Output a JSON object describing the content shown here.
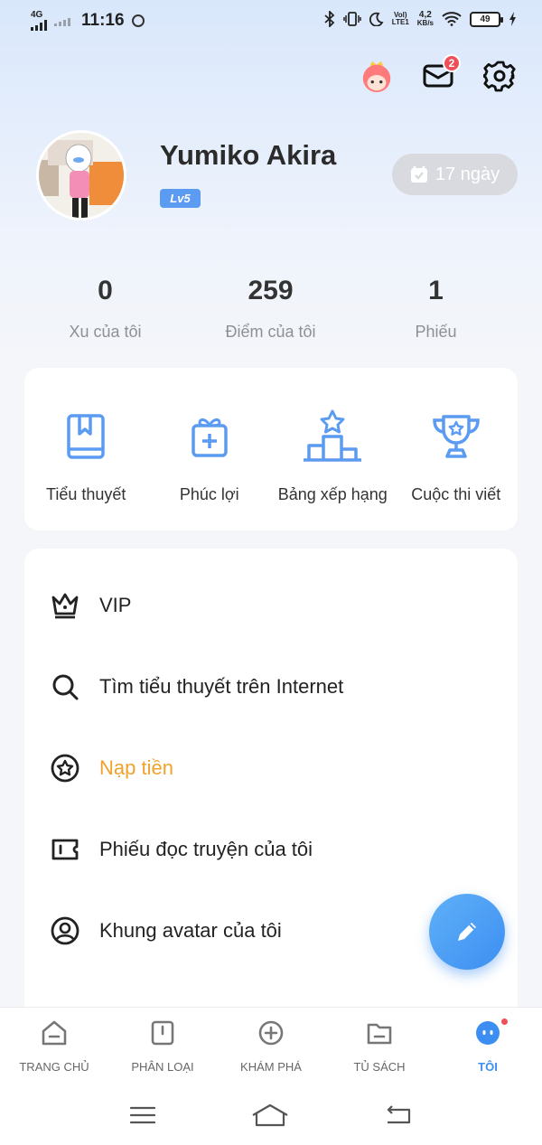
{
  "status_bar": {
    "network": "4G",
    "time": "11:16",
    "volte_top": "Vol)",
    "volte_bottom": "LTE1",
    "speed_top": "4,2",
    "speed_bottom": "KB/s",
    "battery": "49"
  },
  "header": {
    "mail_badge": "2"
  },
  "profile": {
    "name": "Yumiko Akira",
    "level": "Lv5",
    "checkin_label": "17 ngày"
  },
  "stats": [
    {
      "value": "0",
      "label": "Xu của tôi"
    },
    {
      "value": "259",
      "label": "Điểm của tôi"
    },
    {
      "value": "1",
      "label": "Phiếu"
    }
  ],
  "features": [
    {
      "label": "Tiểu thuyết",
      "icon": "book-icon"
    },
    {
      "label": "Phúc lợi",
      "icon": "gift-icon"
    },
    {
      "label": "Bảng xếp hạng",
      "icon": "podium-icon"
    },
    {
      "label": "Cuộc thi viết",
      "icon": "trophy-icon"
    }
  ],
  "menu": [
    {
      "label": "VIP",
      "icon": "crown-icon"
    },
    {
      "label": "Tìm tiểu thuyết trên Internet",
      "icon": "search-icon"
    },
    {
      "label": "Nạp tiền",
      "icon": "star-circle-icon"
    },
    {
      "label": "Phiếu đọc truyện của tôi",
      "icon": "ticket-icon"
    },
    {
      "label": "Khung avatar của tôi",
      "icon": "avatar-frame-icon"
    }
  ],
  "bottom_nav": [
    {
      "label": "TRANG CHỦ",
      "icon": "home-icon"
    },
    {
      "label": "PHÂN LOẠI",
      "icon": "category-icon"
    },
    {
      "label": "KHÁM PHÁ",
      "icon": "explore-icon"
    },
    {
      "label": "TỦ SÁCH",
      "icon": "bookshelf-icon"
    },
    {
      "label": "TÔI",
      "icon": "me-icon"
    }
  ],
  "colors": {
    "accent": "#3d8ef2",
    "highlight": "#f0a22c",
    "badge": "#ef4f58"
  }
}
